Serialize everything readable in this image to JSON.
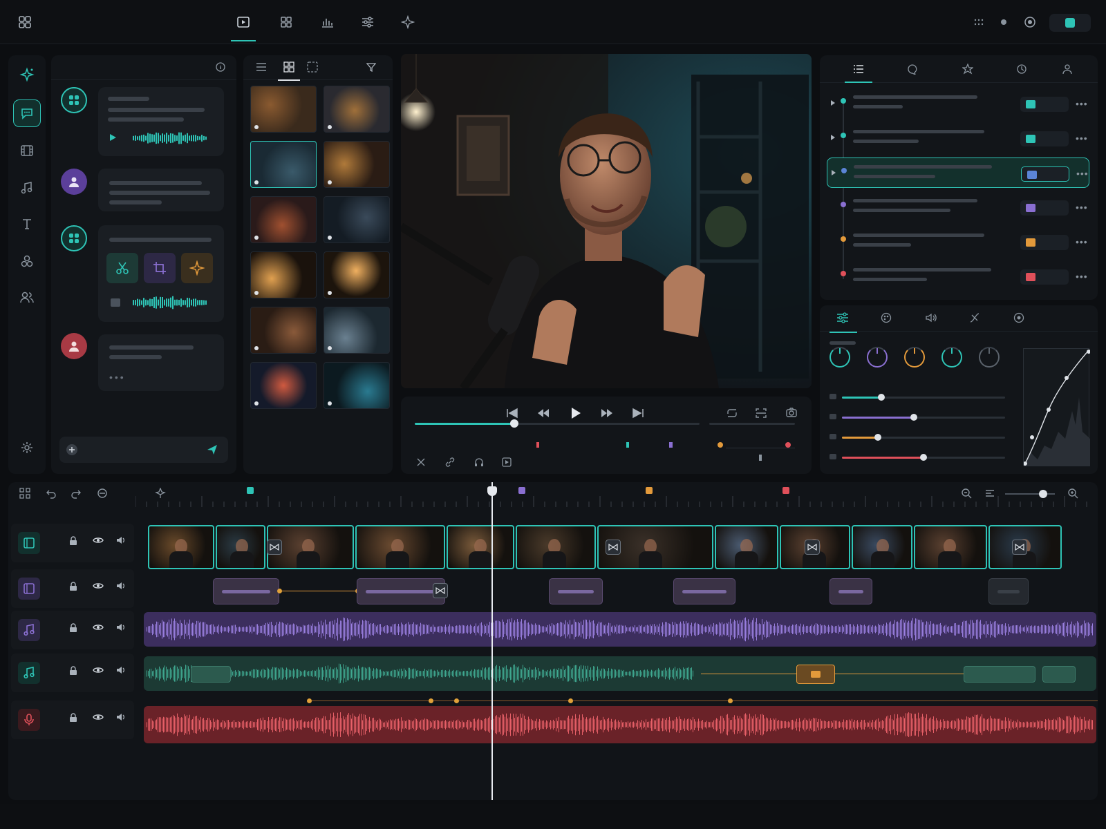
{
  "colors": {
    "accent": "#2ec4b6",
    "purple": "#8a6fd1",
    "orange": "#e39a3b",
    "red": "#e0505a",
    "blue": "#5b84d6",
    "bg": "#0c0e11"
  },
  "topbar": {
    "tabs": [
      "play-tab",
      "grid-tab",
      "audio-levels-tab",
      "adjust-tab",
      "ai-tab"
    ],
    "active_tab": "play-tab"
  },
  "rail": {
    "items": [
      "ai-sparkle",
      "chat",
      "film",
      "music",
      "text",
      "effects",
      "people",
      "settings"
    ],
    "active": "chat"
  },
  "chat": {
    "messages": [
      {
        "role": "assistant",
        "type": "voice"
      },
      {
        "role": "user",
        "type": "text"
      },
      {
        "role": "assistant",
        "type": "actions",
        "actions": [
          "cut",
          "crop",
          "enhance"
        ]
      },
      {
        "role": "user",
        "type": "typing"
      }
    ]
  },
  "media": {
    "view_modes": [
      "list",
      "grid",
      "compact"
    ],
    "active_view": "grid",
    "thumbnails": 12,
    "selected_index": 2
  },
  "transport": {
    "progress": 0.35,
    "buttons": [
      "skip-back",
      "rewind",
      "play",
      "fast-forward",
      "skip-forward"
    ]
  },
  "right_panel": {
    "tabs": [
      "list",
      "comments",
      "favorites",
      "history",
      "user"
    ],
    "active_tab": "list",
    "rows": [
      {
        "color": "#2ec4b6",
        "selected": false
      },
      {
        "color": "#2ec4b6",
        "selected": false
      },
      {
        "color": "#5b84d6",
        "selected": true
      },
      {
        "color": "#8a6fd1",
        "selected": false
      },
      {
        "color": "#e39a3b",
        "selected": false
      },
      {
        "color": "#e0505a",
        "selected": false
      }
    ]
  },
  "color_panel": {
    "tabs": [
      "sliders",
      "color",
      "audio",
      "curves",
      "target"
    ],
    "active_tab": "sliders",
    "knobs": [
      "#2ec4b6",
      "#8a6fd1",
      "#e39a3b",
      "#2ec4b6",
      "#5a626b"
    ],
    "sliders": [
      {
        "color": "#2ec4b6",
        "value": 0.24
      },
      {
        "color": "#8a6fd1",
        "value": 0.44
      },
      {
        "color": "#e39a3b",
        "value": 0.22
      },
      {
        "color": "#e0505a",
        "value": 0.5
      }
    ]
  },
  "timeline": {
    "zoom": 0.6,
    "markers": [
      {
        "color": "#2ec4b6"
      },
      {
        "color": "#8a6fd1"
      },
      {
        "color": "#e39a3b"
      },
      {
        "color": "#e0505a"
      }
    ],
    "tracks": [
      {
        "type": "video",
        "icon": "film-icon"
      },
      {
        "type": "title",
        "icon": "title-icon"
      },
      {
        "type": "music",
        "icon": "music-icon"
      },
      {
        "type": "music",
        "icon": "music-icon"
      },
      {
        "type": "voice",
        "icon": "mic-icon"
      }
    ]
  }
}
